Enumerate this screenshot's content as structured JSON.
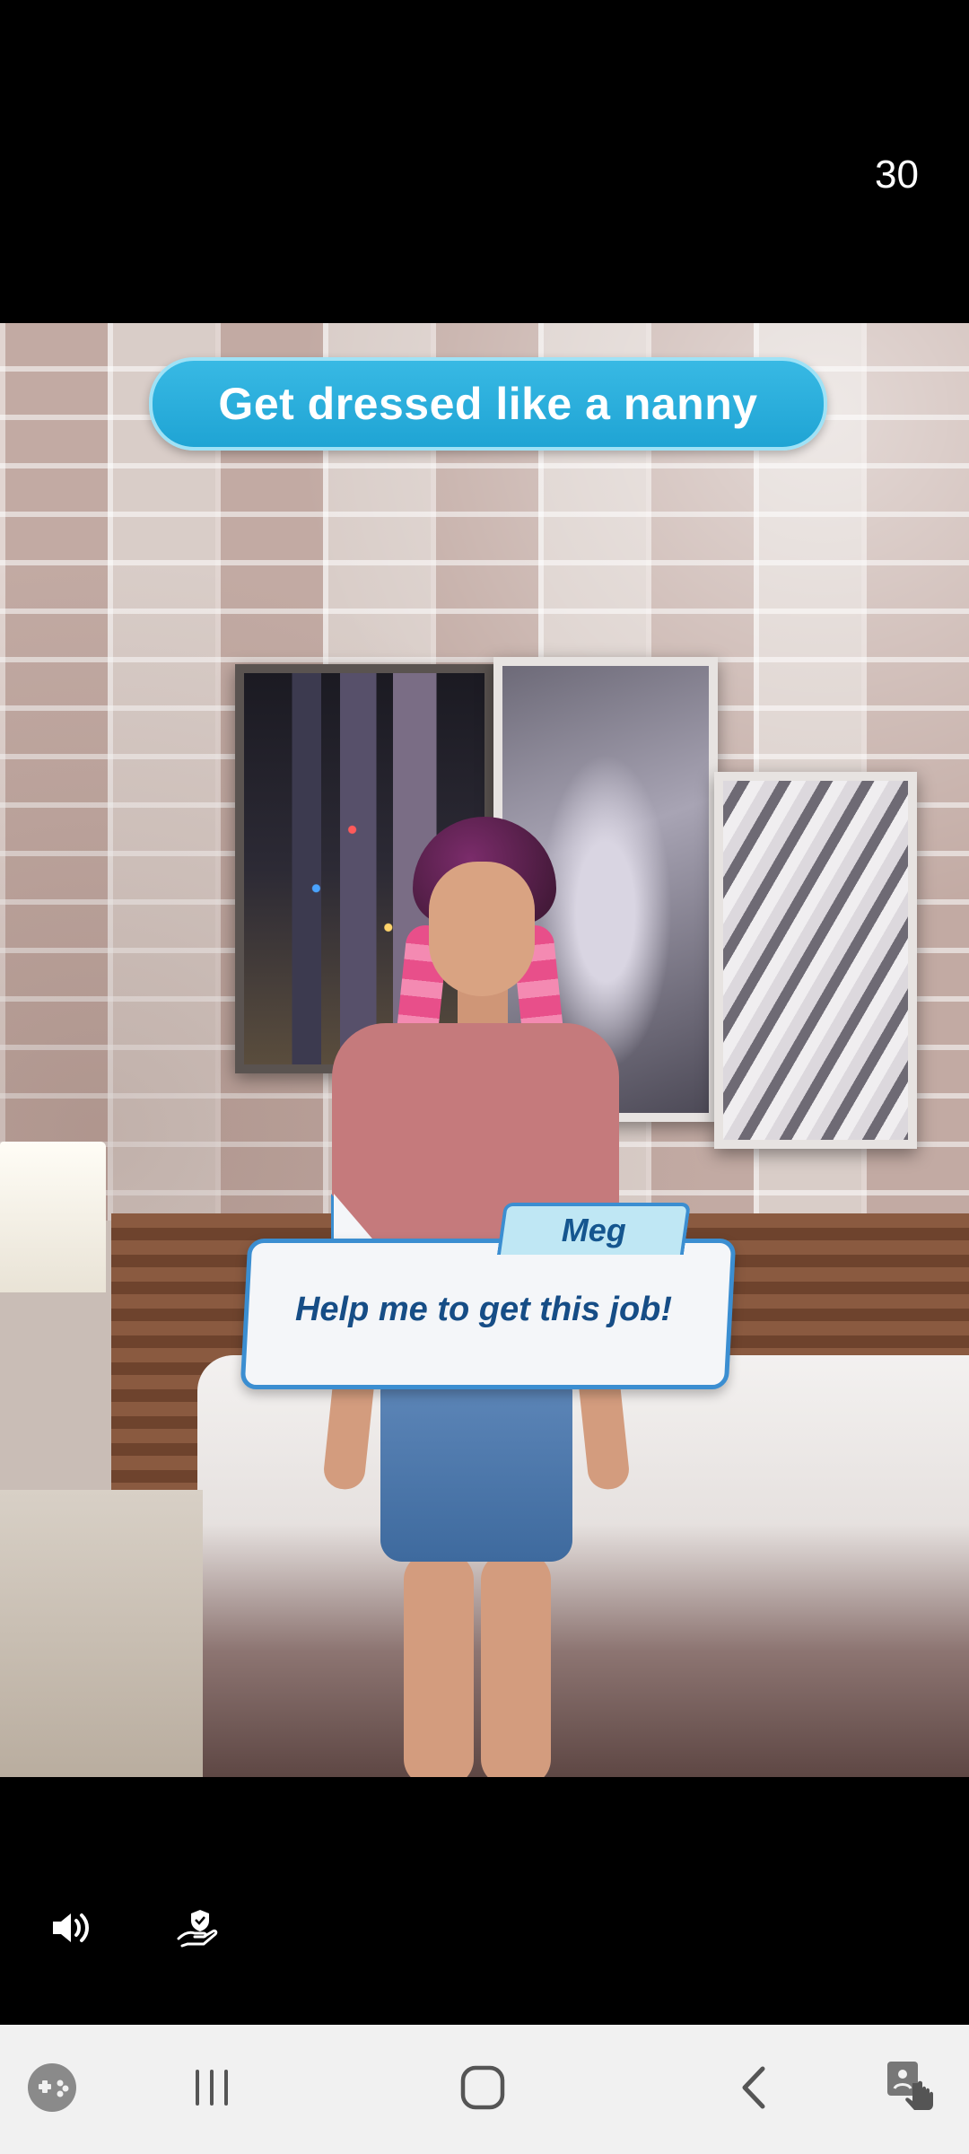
{
  "status": {
    "countdown": "30"
  },
  "game": {
    "task_banner": "Get dressed like a nanny",
    "dialogue": {
      "speaker": "Meg",
      "text": "Help me to get this job!"
    }
  },
  "controls": {
    "sound_icon": "speaker-volume-icon",
    "consent_icon": "privacy-hand-shield-icon"
  },
  "nav": {
    "game_tools_icon": "game-controller-icon",
    "recent_icon": "recent-apps-icon",
    "home_icon": "home-icon",
    "back_icon": "back-chevron-icon",
    "assist_icon": "touch-assist-icon"
  },
  "colors": {
    "banner": "#2ab0de",
    "dialogue_border": "#3b8ed1",
    "dialogue_text": "#164d86",
    "nav_background": "#f1f1f1"
  }
}
